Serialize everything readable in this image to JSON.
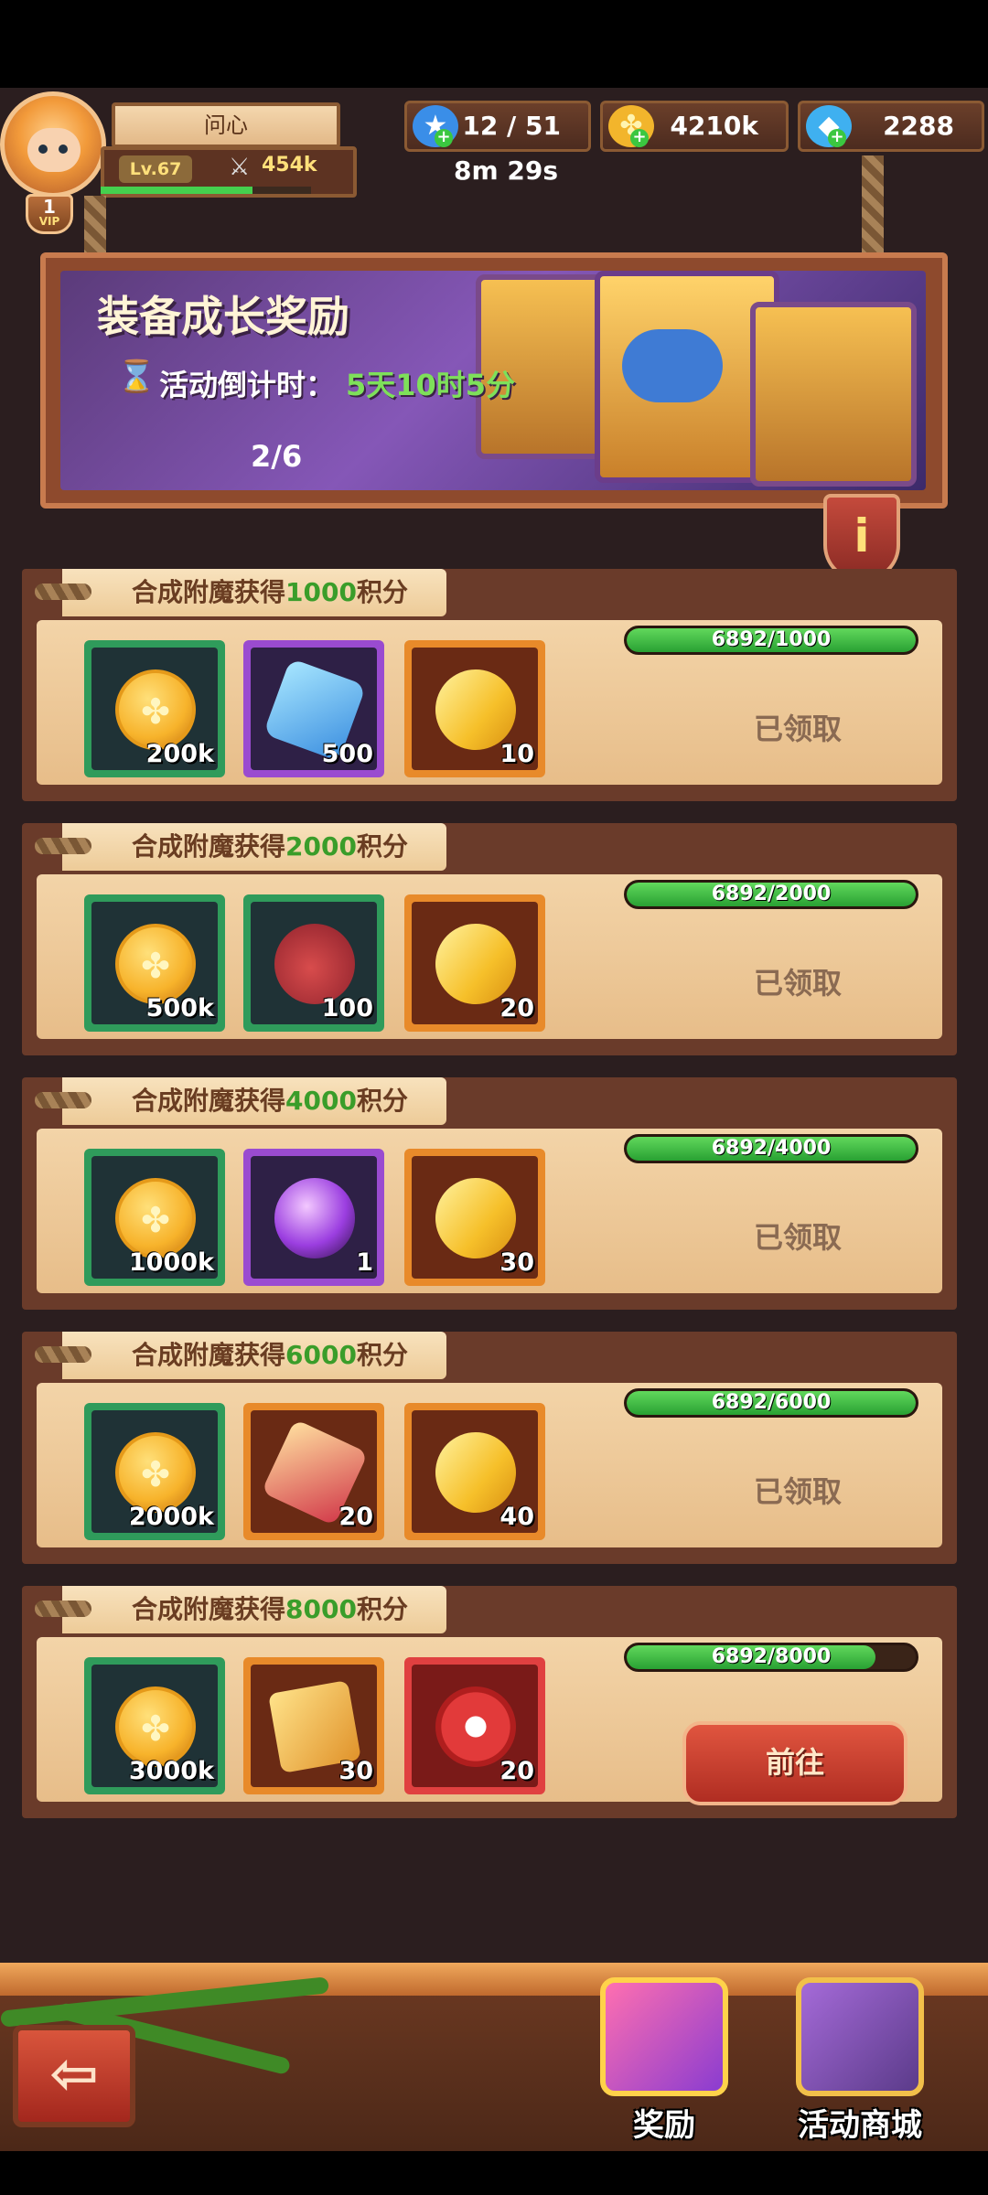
{
  "player": {
    "name": "问心",
    "level": "Lv.67",
    "power": "454k",
    "vip_number": "1",
    "vip_label": "VIP",
    "exp_progress": 0.72
  },
  "resources": {
    "energy": "12 / 51",
    "energy_timer": "8m 29s",
    "gold": "4210k",
    "gems": "2288"
  },
  "banner": {
    "title": "装备成长奖励",
    "countdown_label": "活动倒计时：",
    "countdown_value": "5天10时5分",
    "page_indicator": "2/6",
    "info_icon": "i"
  },
  "rewards": [
    {
      "header_prefix": "合成附魔获得",
      "header_value": "1000",
      "header_suffix": "积分",
      "progress_text": "6892/1000",
      "progress": 1.0,
      "status": "已领取",
      "items": [
        {
          "icon": "gold-coin",
          "qty": "200k",
          "frame": "green"
        },
        {
          "icon": "blue-crystal",
          "qty": "500",
          "frame": "purple"
        },
        {
          "icon": "gold-ore",
          "qty": "10",
          "frame": "orange"
        }
      ]
    },
    {
      "header_prefix": "合成附魔获得",
      "header_value": "2000",
      "header_suffix": "积分",
      "progress_text": "6892/2000",
      "progress": 1.0,
      "status": "已领取",
      "items": [
        {
          "icon": "gold-coin",
          "qty": "500k",
          "frame": "green"
        },
        {
          "icon": "red-pouch",
          "qty": "100",
          "frame": "green"
        },
        {
          "icon": "gold-ore",
          "qty": "20",
          "frame": "orange"
        }
      ]
    },
    {
      "header_prefix": "合成附魔获得",
      "header_value": "4000",
      "header_suffix": "积分",
      "progress_text": "6892/4000",
      "progress": 1.0,
      "status": "已领取",
      "items": [
        {
          "icon": "gold-coin",
          "qty": "1000k",
          "frame": "green"
        },
        {
          "icon": "magic-staff",
          "qty": "1",
          "frame": "purple"
        },
        {
          "icon": "gold-ore",
          "qty": "30",
          "frame": "orange"
        }
      ]
    },
    {
      "header_prefix": "合成附魔获得",
      "header_value": "6000",
      "header_suffix": "积分",
      "progress_text": "6892/6000",
      "progress": 1.0,
      "status": "已领取",
      "items": [
        {
          "icon": "gold-coin",
          "qty": "2000k",
          "frame": "green"
        },
        {
          "icon": "rose-scroll",
          "qty": "20",
          "frame": "orange"
        },
        {
          "icon": "gold-ore",
          "qty": "40",
          "frame": "orange"
        }
      ]
    },
    {
      "header_prefix": "合成附魔获得",
      "header_value": "8000",
      "header_suffix": "积分",
      "progress_text": "6892/8000",
      "progress": 0.86,
      "status": "",
      "button_label": "前往",
      "items": [
        {
          "icon": "gold-coin",
          "qty": "3000k",
          "frame": "green"
        },
        {
          "icon": "golden-cross",
          "qty": "30",
          "frame": "orange"
        },
        {
          "icon": "paw-token",
          "qty": "20",
          "frame": "red"
        }
      ]
    }
  ],
  "bottom_nav": {
    "back_icon": "arrow-left-icon",
    "reward_label": "奖励",
    "shop_label": "活动商城"
  },
  "colors": {
    "background": "#2b1e1f",
    "accent_green": "#3a9d2a",
    "progress_green": "#29a133",
    "button_red": "#b02d22"
  }
}
